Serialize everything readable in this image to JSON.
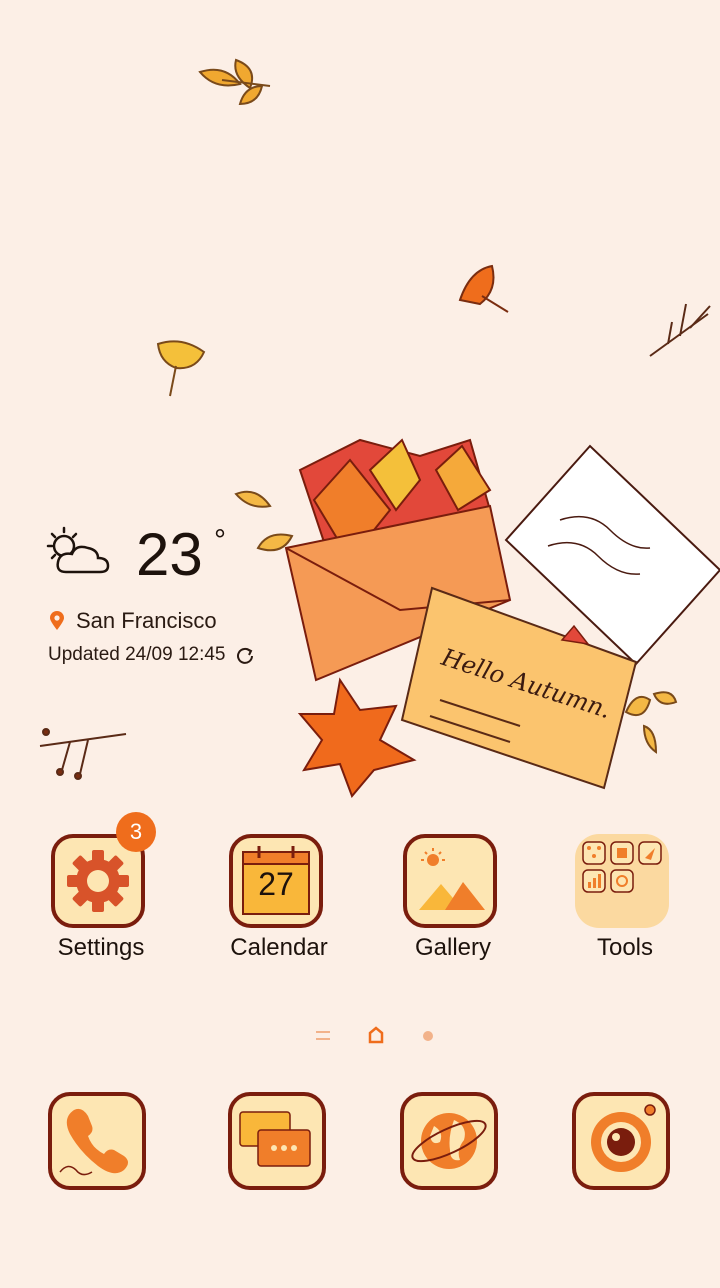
{
  "weather": {
    "temperature": "23",
    "degree_symbol": "°",
    "location": "San Francisco",
    "updated": "Updated 24/09 12:45",
    "icon": "partly-cloudy-icon"
  },
  "apps": [
    {
      "label": "Settings",
      "icon": "settings-gear-icon",
      "badge": "3"
    },
    {
      "label": "Calendar",
      "icon": "calendar-icon",
      "date": "27"
    },
    {
      "label": "Gallery",
      "icon": "gallery-icon"
    },
    {
      "label": "Tools",
      "icon": "tools-folder-icon"
    }
  ],
  "dock": [
    {
      "icon": "phone-icon"
    },
    {
      "icon": "messages-icon"
    },
    {
      "icon": "browser-icon"
    },
    {
      "icon": "camera-icon"
    }
  ],
  "page_indicator": {
    "pages": [
      "menu",
      "home",
      "page"
    ],
    "active": "home"
  },
  "colors": {
    "background": "#fcefe6",
    "accent": "#ef6d1c",
    "tile_border": "#7a1d0d",
    "tile_fill": "#fde6b3"
  }
}
